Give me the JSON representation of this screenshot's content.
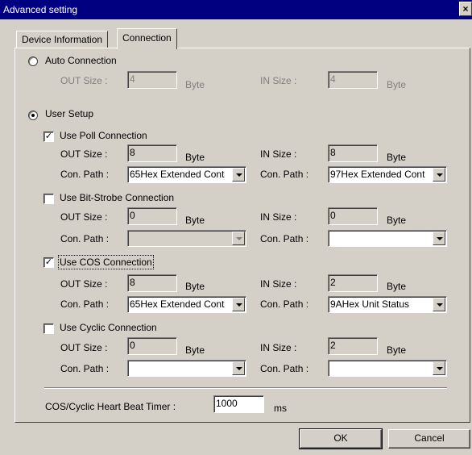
{
  "window": {
    "title": "Advanced setting",
    "close_label": "×"
  },
  "tabs": [
    {
      "label": "Device Information",
      "active": false
    },
    {
      "label": "Connection",
      "active": true
    }
  ],
  "auto_connection": {
    "label": "Auto Connection",
    "selected": false,
    "out_size_label": "OUT Size :",
    "out_size": "4",
    "in_size_label": "IN Size :",
    "in_size": "4",
    "unit": "Byte"
  },
  "user_setup": {
    "label": "User Setup",
    "selected": true,
    "sections": [
      {
        "label": "Use Poll Connection",
        "checked": true,
        "mark": "✓",
        "out_size_label": "OUT Size :",
        "out_size": "8",
        "in_size_label": "IN Size :",
        "in_size": "8",
        "unit": "Byte",
        "out_path_label": "Con. Path :",
        "out_path": "65Hex Extended Cont",
        "in_path_label": "Con. Path :",
        "in_path": "97Hex Extended Cont"
      },
      {
        "label": "Use Bit-Strobe Connection",
        "checked": false,
        "mark": "",
        "out_size_label": "OUT Size :",
        "out_size": "0",
        "in_size_label": "IN Size :",
        "in_size": "0",
        "unit": "Byte",
        "out_path_label": "Con. Path :",
        "out_path": "",
        "in_path_label": "Con. Path :",
        "in_path": ""
      },
      {
        "label": "Use COS Connection",
        "checked": true,
        "mark": "✓",
        "out_size_label": "OUT Size :",
        "out_size": "8",
        "in_size_label": "IN Size :",
        "in_size": "2",
        "unit": "Byte",
        "out_path_label": "Con. Path :",
        "out_path": "65Hex Extended Cont",
        "in_path_label": "Con. Path :",
        "in_path": "9AHex Unit Status"
      },
      {
        "label": "Use Cyclic Connection",
        "checked": false,
        "mark": "",
        "out_size_label": "OUT Size :",
        "out_size": "0",
        "in_size_label": "IN Size :",
        "in_size": "2",
        "unit": "Byte",
        "out_path_label": "Con. Path :",
        "out_path": "",
        "in_path_label": "Con. Path :",
        "in_path": ""
      }
    ]
  },
  "heartbeat": {
    "label": "COS/Cyclic Heart Beat Timer :",
    "value": "1000",
    "unit": "ms"
  },
  "buttons": {
    "ok": "OK",
    "cancel": "Cancel"
  }
}
